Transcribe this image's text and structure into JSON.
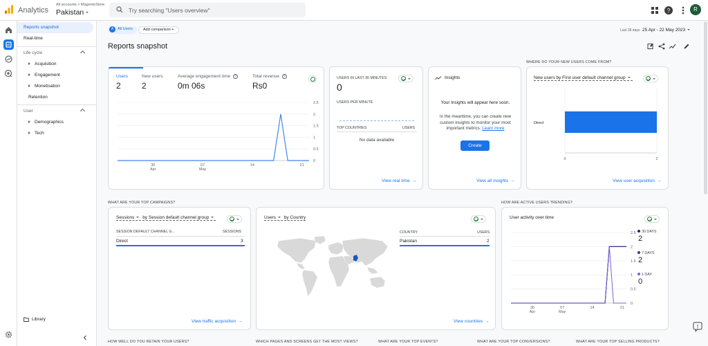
{
  "header": {
    "app_title": "Analytics",
    "breadcrumb": "All accounts > MagentoStore",
    "property": "Pakistan",
    "search_placeholder": "Try searching \"Users overview\"",
    "avatar_letter": "R"
  },
  "nav": {
    "reports_snapshot": "Reports snapshot",
    "realtime": "Real-time",
    "lifecycle_heading": "Life cycle",
    "acquisition": "Acquisition",
    "engagement": "Engagement",
    "monetisation": "Monetisation",
    "retention": "Retention",
    "user_heading": "User",
    "demographics": "Demographics",
    "tech": "Tech",
    "library": "Library"
  },
  "toolbar": {
    "segment_badge": "A",
    "segment_label": "All Users",
    "add_comparison": "Add comparison",
    "add_icon": "+",
    "date_label": "Last 28 days",
    "date_range": "25 Apr - 22 May 2023"
  },
  "page_title": "Reports snapshot",
  "overview": {
    "metrics": [
      {
        "label": "Users",
        "value": "2"
      },
      {
        "label": "New users",
        "value": "2"
      },
      {
        "label": "Average engagement time",
        "value": "0m 06s"
      },
      {
        "label": "Total revenue",
        "value": "Rs0"
      }
    ],
    "help_glyph": "?"
  },
  "realtime_card": {
    "title": "USERS IN LAST 30 MINUTES",
    "value": "0",
    "per_minute": "USERS PER MINUTE",
    "col_countries": "TOP COUNTRIES",
    "col_users": "USERS",
    "empty": "No data available",
    "link": "View real time"
  },
  "insights_card": {
    "title": "Insights",
    "headline": "Your Insights will appear here soon.",
    "body": "In the meantime, you can create new custom insights to monitor your most important metrics.",
    "learn_more": "Learn more",
    "create": "Create",
    "link": "View all insights"
  },
  "new_users_section": {
    "heading": "WHERE DO YOUR NEW USERS COME FROM?",
    "selector": "New users by First user default channel group",
    "link": "View user acquisition"
  },
  "campaigns_section": {
    "heading": "WHAT ARE YOUR TOP CAMPAIGNS?",
    "selector_metric": "Sessions",
    "selector_dim": "by Session default channel group",
    "col_channel": "SESSION DEFAULT CHANNEL G...",
    "col_sessions": "SESSIONS",
    "rows": [
      {
        "name": "Direct",
        "value": "3"
      }
    ],
    "link": "View traffic acquisition"
  },
  "country_card": {
    "selector_metric": "Users",
    "selector_dim": "by Country",
    "col_country": "COUNTRY",
    "col_users": "USERS",
    "rows": [
      {
        "name": "Pakistan",
        "value": "2"
      }
    ],
    "link": "View countries"
  },
  "trend_section": {
    "heading": "HOW ARE ACTIVE USERS TRENDING?",
    "title": "User activity over time",
    "legend": [
      {
        "label": "30 DAYS",
        "value": "2",
        "color": "#1a237e"
      },
      {
        "label": "7 DAYS",
        "value": "2",
        "color": "#4a2d8f"
      },
      {
        "label": "1 DAY",
        "value": "0",
        "color": "#7b61d6"
      }
    ]
  },
  "bottom_headings": {
    "retain": "HOW WELL DO YOU RETAIN YOUR USERS?",
    "pages": "WHICH PAGES AND SCREENS GET THE MOST VIEWS?",
    "events": "WHAT ARE YOUR TOP EVENTS?",
    "conversions": "WHAT ARE YOUR TOP CONVERSIONS?",
    "products": "WHAT ARE YOUR TOP SELLING PRODUCTS?"
  },
  "colors": {
    "accent": "#1a73e8",
    "map_land": "#d9d9d9",
    "map_highlight": "#1a56c4"
  },
  "chart_data": [
    {
      "type": "line",
      "x_tick_labels": [
        "30",
        "07",
        "14",
        "21"
      ],
      "x_tick_sublabels": [
        "Apr",
        "May",
        "",
        ""
      ],
      "x": [
        "25 Apr",
        "26 Apr",
        "27 Apr",
        "28 Apr",
        "29 Apr",
        "30 Apr",
        "1 May",
        "2 May",
        "3 May",
        "4 May",
        "5 May",
        "6 May",
        "7 May",
        "8 May",
        "9 May",
        "10 May",
        "11 May",
        "12 May",
        "13 May",
        "14 May",
        "15 May",
        "16 May",
        "17 May",
        "18 May",
        "19 May",
        "20 May",
        "21 May",
        "22 May"
      ],
      "series": [
        {
          "values": [
            0,
            0,
            0,
            0,
            0,
            0,
            0,
            0,
            0,
            0,
            0,
            0,
            0,
            0,
            0,
            0,
            0,
            0,
            0,
            0,
            0,
            0,
            0,
            2,
            0,
            0,
            0,
            0
          ],
          "color": "#4285f4"
        }
      ],
      "y_ticks": [
        "2.5",
        "2",
        "1.5",
        "1",
        "0.5",
        "0"
      ],
      "ylim": [
        0,
        2.5
      ],
      "grid": true
    },
    {
      "type": "bar",
      "orientation": "horizontal",
      "categories": [
        "Direct"
      ],
      "values": [
        2
      ],
      "x_ticks": [
        "0",
        "2"
      ],
      "xlim": [
        0,
        2
      ],
      "color": "#1a73e8"
    },
    {
      "type": "line",
      "x_tick_labels": [
        "30",
        "07",
        "14",
        "21"
      ],
      "x_tick_sublabels": [
        "Apr",
        "May",
        "",
        ""
      ],
      "x": [
        "25 Apr",
        "26 Apr",
        "27 Apr",
        "28 Apr",
        "29 Apr",
        "30 Apr",
        "1 May",
        "2 May",
        "3 May",
        "4 May",
        "5 May",
        "6 May",
        "7 May",
        "8 May",
        "9 May",
        "10 May",
        "11 May",
        "12 May",
        "13 May",
        "14 May",
        "15 May",
        "16 May",
        "17 May",
        "18 May",
        "19 May",
        "20 May",
        "21 May",
        "22 May"
      ],
      "series": [
        {
          "name": "30 DAYS",
          "values": [
            0,
            0,
            0,
            0,
            0,
            0,
            0,
            0,
            0,
            0,
            0,
            0,
            0,
            0,
            0,
            0,
            0,
            0,
            0,
            0,
            0,
            0,
            0,
            2,
            2,
            2,
            2,
            2
          ],
          "color": "#1a237e"
        },
        {
          "name": "7 DAYS",
          "values": [
            0,
            0,
            0,
            0,
            0,
            0,
            0,
            0,
            0,
            0,
            0,
            0,
            0,
            0,
            0,
            0,
            0,
            0,
            0,
            0,
            0,
            0,
            0,
            2,
            2,
            2,
            2,
            2
          ],
          "color": "#4a2d8f"
        },
        {
          "name": "1 DAY",
          "values": [
            0,
            0,
            0,
            0,
            0,
            0,
            0,
            0,
            0,
            0,
            0,
            0,
            0,
            0,
            0,
            0,
            0,
            0,
            0,
            0,
            0,
            0,
            0,
            2,
            0,
            0,
            0,
            0
          ],
          "color": "#7b61d6"
        }
      ],
      "y_ticks": [
        "2.5",
        "2",
        "1.5",
        "1",
        "0.5",
        "0"
      ],
      "ylim": [
        0,
        2.5
      ],
      "grid": true
    }
  ]
}
